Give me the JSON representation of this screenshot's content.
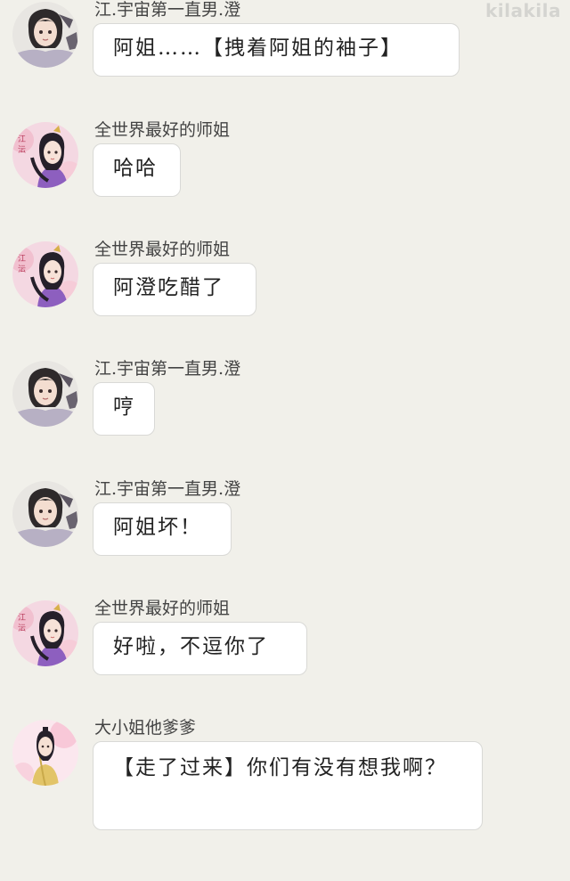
{
  "watermark": "kilakila",
  "messages": [
    {
      "sender": "江.宇宙第一直男.澄",
      "text": "阿姐……【拽着阿姐的袖子】",
      "avatar": "jiang-cheng-avatar"
    },
    {
      "sender": "全世界最好的师姐",
      "text": "哈哈",
      "avatar": "shijie-avatar"
    },
    {
      "sender": "全世界最好的师姐",
      "text": "阿澄吃醋了",
      "avatar": "shijie-avatar"
    },
    {
      "sender": "江.宇宙第一直男.澄",
      "text": "哼",
      "avatar": "jiang-cheng-avatar"
    },
    {
      "sender": "江.宇宙第一直男.澄",
      "text": "阿姐坏！",
      "avatar": "jiang-cheng-avatar"
    },
    {
      "sender": "全世界最好的师姐",
      "text": "好啦，不逗你了",
      "avatar": "shijie-avatar"
    },
    {
      "sender": "大小姐他爹爹",
      "text": "【走了过来】你们有没有想我啊？",
      "avatar": "dad-avatar"
    }
  ],
  "colors": {
    "background": "#f1f0ea",
    "bubble": "#ffffff",
    "bubble_border": "#d9d9d6"
  }
}
